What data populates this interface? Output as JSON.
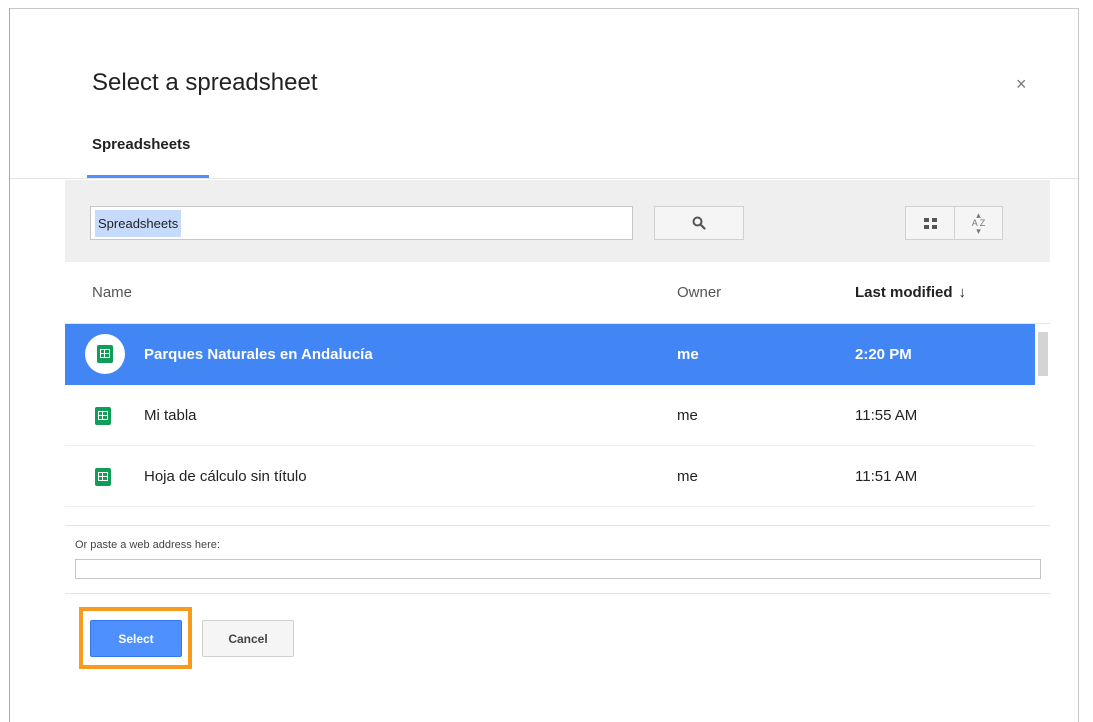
{
  "dialog": {
    "title": "Select a spreadsheet",
    "close_icon": "×"
  },
  "tabs": [
    {
      "label": "Spreadsheets",
      "active": true
    }
  ],
  "toolbar": {
    "search_value": "Spreadsheets",
    "search_icon": "search-icon",
    "view_icon": "grid-view-icon",
    "sort_icon": "sort-az-icon"
  },
  "table": {
    "headers": {
      "name": "Name",
      "owner": "Owner",
      "modified": "Last modified",
      "sort_arrow": "↓"
    },
    "rows": [
      {
        "name": "Parques Naturales en Andalucía",
        "owner": "me",
        "modified": "2:20 PM",
        "selected": true
      },
      {
        "name": "Mi tabla",
        "owner": "me",
        "modified": "11:55 AM",
        "selected": false
      },
      {
        "name": "Hoja de cálculo sin título",
        "owner": "me",
        "modified": "11:51 AM",
        "selected": false
      }
    ]
  },
  "paste": {
    "label": "Or paste a web address here:",
    "value": ""
  },
  "footer": {
    "select_label": "Select",
    "cancel_label": "Cancel"
  },
  "colors": {
    "accent": "#4285f4",
    "sheet_icon": "#0f9d58",
    "highlight": "#f79a1e"
  }
}
